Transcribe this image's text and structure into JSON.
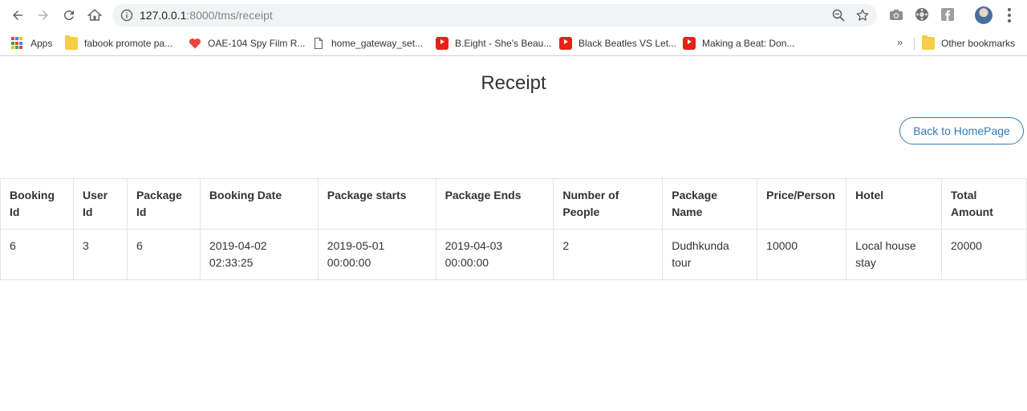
{
  "browser": {
    "url_host": "127.0.0.1",
    "url_rest": ":8000/tms/receipt",
    "bookmarks": [
      {
        "label": "Apps",
        "icon": "apps-grid-icon"
      },
      {
        "label": "fabook promote pa...",
        "icon": "folder-icon"
      },
      {
        "label": "OAE-104 Spy Film R...",
        "icon": "heart-icon"
      },
      {
        "label": "home_gateway_set...",
        "icon": "page-icon"
      },
      {
        "label": "B.Eight - She's Beau...",
        "icon": "youtube-icon"
      },
      {
        "label": "Black Beatles VS Let...",
        "icon": "youtube-icon"
      },
      {
        "label": "Making a Beat: Don...",
        "icon": "youtube-icon"
      }
    ],
    "more_bookmarks": "»",
    "other_bookmarks": "Other bookmarks"
  },
  "page": {
    "title": "Receipt",
    "back_button": "Back to HomePage"
  },
  "table": {
    "headers": [
      "Booking Id",
      "User Id",
      "Package Id",
      "Booking Date",
      "Package starts",
      "Package Ends",
      "Number of People",
      "Package Name",
      "Price/Person",
      "Hotel",
      "Total Amount"
    ],
    "rows": [
      [
        "6",
        "3",
        "6",
        "2019-04-02 02:33:25",
        "2019-05-01 00:00:00",
        "2019-04-03 00:00:00",
        "2",
        "Dudhkunda tour",
        "10000",
        "Local house stay",
        "20000"
      ]
    ]
  }
}
